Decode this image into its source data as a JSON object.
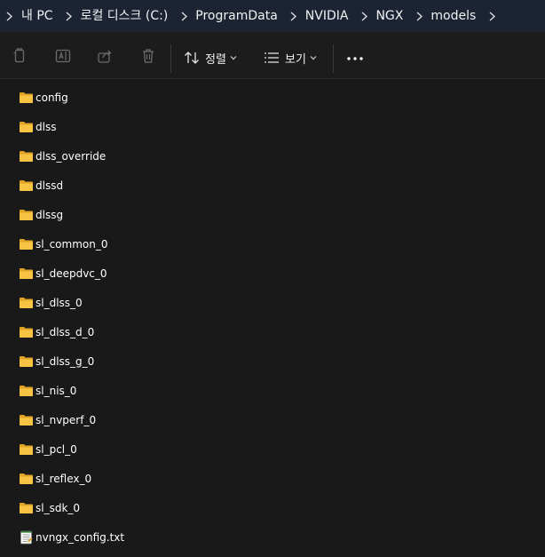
{
  "address_bar": {
    "crumbs": [
      "내 PC",
      "로컬 디스크 (C:)",
      "ProgramData",
      "NVIDIA",
      "NGX",
      "models"
    ]
  },
  "toolbar": {
    "copy_icon": "copy-icon",
    "rename_icon": "rename-icon",
    "share_icon": "share-icon",
    "delete_icon": "delete-icon",
    "sort_label": "정렬",
    "view_label": "보기",
    "more_icon": "more-icon"
  },
  "files": [
    {
      "name": "config",
      "type": "folder"
    },
    {
      "name": "dlss",
      "type": "folder"
    },
    {
      "name": "dlss_override",
      "type": "folder"
    },
    {
      "name": "dlssd",
      "type": "folder"
    },
    {
      "name": "dlssg",
      "type": "folder"
    },
    {
      "name": "sl_common_0",
      "type": "folder"
    },
    {
      "name": "sl_deepdvc_0",
      "type": "folder"
    },
    {
      "name": "sl_dlss_0",
      "type": "folder"
    },
    {
      "name": "sl_dlss_d_0",
      "type": "folder"
    },
    {
      "name": "sl_dlss_g_0",
      "type": "folder"
    },
    {
      "name": "sl_nis_0",
      "type": "folder"
    },
    {
      "name": "sl_nvperf_0",
      "type": "folder"
    },
    {
      "name": "sl_pcl_0",
      "type": "folder"
    },
    {
      "name": "sl_reflex_0",
      "type": "folder"
    },
    {
      "name": "sl_sdk_0",
      "type": "folder"
    },
    {
      "name": "nvngx_config.txt",
      "type": "text-file"
    }
  ],
  "colors": {
    "address_bar_bg": "#1c2333",
    "window_bg": "#191919",
    "folder": "#f6c343",
    "folder_back": "#e0a524"
  }
}
